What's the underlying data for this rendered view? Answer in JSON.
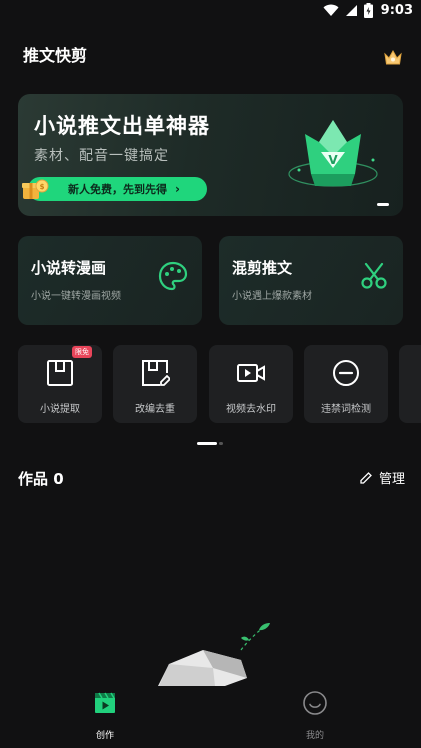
{
  "status_bar": {
    "time": "9:03"
  },
  "header": {
    "title": "推文快剪"
  },
  "banner": {
    "title": "小说推文出单神器",
    "subtitle": "素材、配音一键搞定",
    "cta_label": "新人免费，先到先得",
    "cta_chevron": "›"
  },
  "features": [
    {
      "title": "小说转漫画",
      "subtitle": "小说一键转漫画视频",
      "icon": "palette-icon"
    },
    {
      "title": "混剪推文",
      "subtitle": "小说遇上爆款素材",
      "icon": "scissors-icon"
    }
  ],
  "tools": [
    {
      "label": "小说提取",
      "badge": "限免",
      "icon": "extract-icon"
    },
    {
      "label": "改编去重",
      "icon": "edit-save-icon"
    },
    {
      "label": "视频去水印",
      "icon": "video-camera-icon"
    },
    {
      "label": "违禁词检测",
      "icon": "minus-circle-icon"
    }
  ],
  "works": {
    "title": "作品 0",
    "manage_label": "管理"
  },
  "tabbar": {
    "items": [
      {
        "label": "创作",
        "active": true,
        "icon": "clapperboard-icon"
      },
      {
        "label": "我的",
        "active": false,
        "icon": "smiley-icon"
      }
    ]
  },
  "colors": {
    "accent": "#1fd67c",
    "background": "#111112",
    "badge": "#e8455a"
  }
}
